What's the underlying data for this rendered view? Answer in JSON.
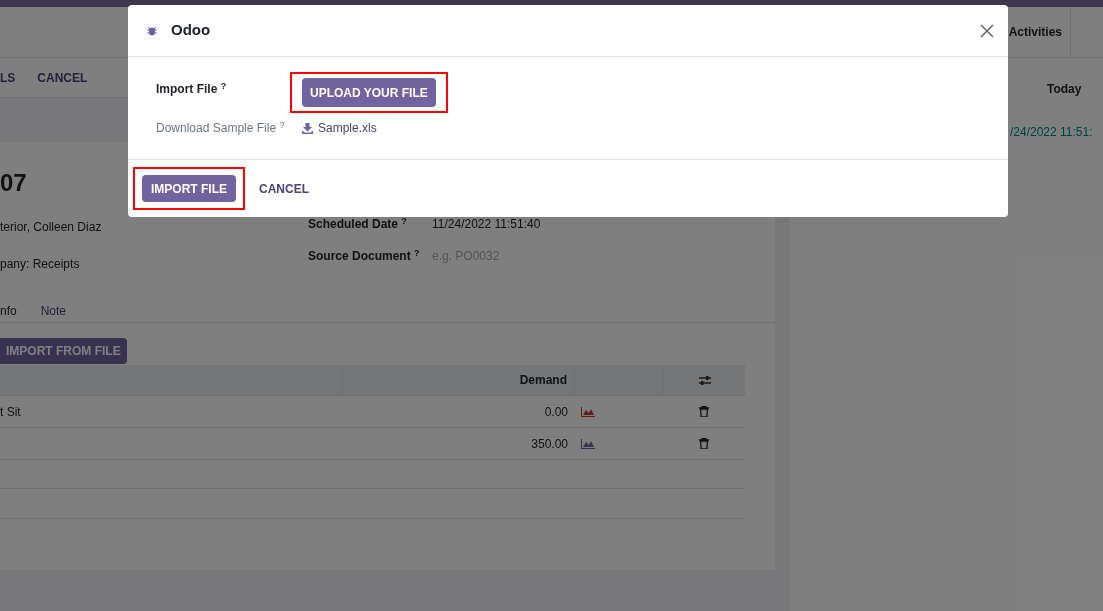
{
  "control_panel": {
    "activities_button": "Activities",
    "actions": [
      "LS",
      "CANCEL"
    ]
  },
  "form": {
    "title": "07",
    "left_texts": [
      "terior, Colleen Diaz",
      "pany: Receipts"
    ],
    "right_fields": [
      {
        "label": "Scheduled Date",
        "help": "?",
        "value": "11/24/2022 11:51:40"
      },
      {
        "label": "Source Document",
        "help": "?",
        "placeholder": "e.g. PO0032"
      }
    ],
    "tabs": [
      "nfo",
      "Note"
    ],
    "import_button": "IMPORT FROM FILE",
    "table": {
      "demand_heading": "Demand",
      "rows": [
        {
          "product": "t Sit",
          "demand": "0.00",
          "kind": "alert"
        },
        {
          "demand": "350.00",
          "kind": "normal"
        }
      ]
    }
  },
  "chatter": {
    "column_heading": "Today",
    "date": "/24/2022 11:51:"
  },
  "dialog": {
    "title": "Odoo",
    "fields": [
      {
        "kind": "upload",
        "label": "Import File",
        "help": "?",
        "button": "UPLOAD YOUR FILE",
        "highlighted": true
      },
      {
        "kind": "download",
        "label": "Download Sample File",
        "help": "?",
        "link": "Sample.xls"
      }
    ],
    "footer_buttons": [
      {
        "kind": "primary",
        "label": "IMPORT FILE",
        "highlighted": true
      },
      {
        "kind": "link",
        "label": "CANCEL",
        "highlighted": false
      }
    ]
  }
}
